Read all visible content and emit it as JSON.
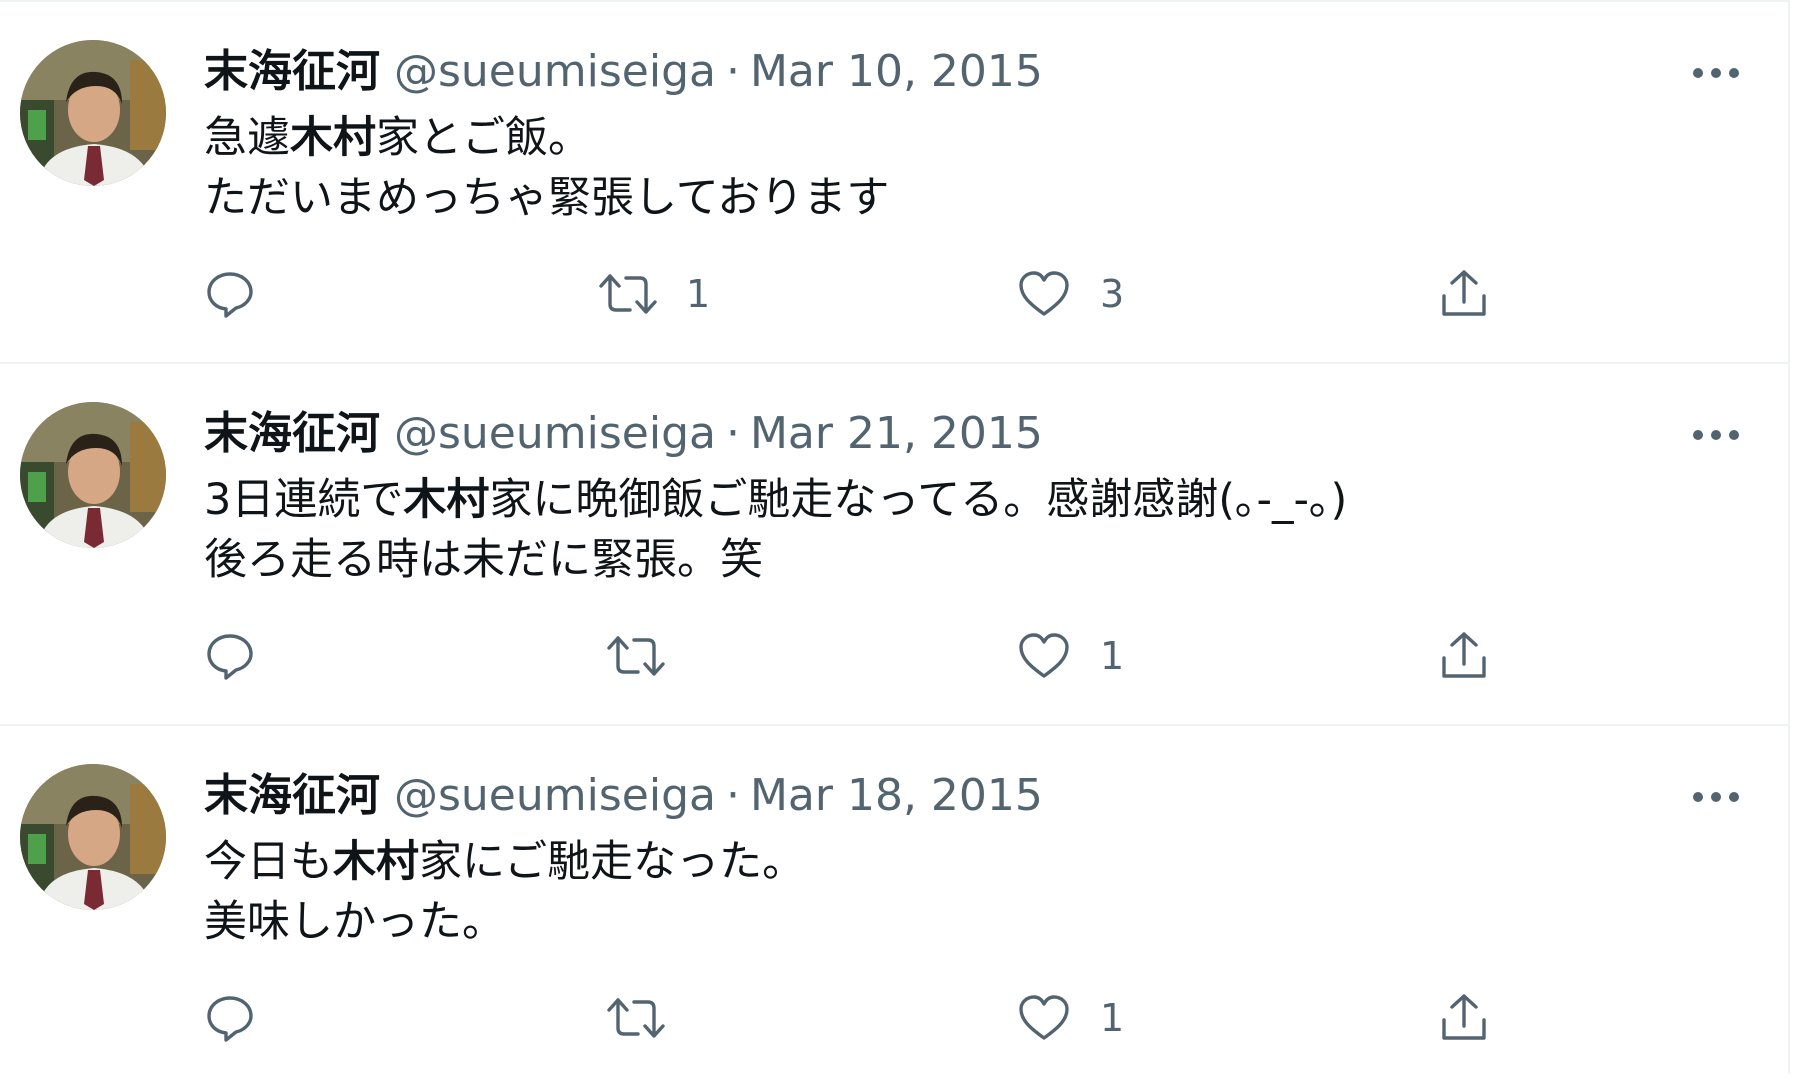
{
  "tweets": [
    {
      "author_name": "末海征河",
      "handle": "@sueumiseiga",
      "separator": "·",
      "date": "Mar 10, 2015",
      "lines": [
        {
          "pre": "急遽",
          "strong": "木村",
          "post": "家とご飯。"
        },
        {
          "pre": "ただいまめっちゃ緊張しております",
          "strong": "",
          "post": ""
        }
      ],
      "retweet_count": "1",
      "like_count": "3"
    },
    {
      "author_name": "末海征河",
      "handle": "@sueumiseiga",
      "separator": "·",
      "date": "Mar 21, 2015",
      "lines": [
        {
          "pre": "3日連続で",
          "strong": "木村",
          "post": "家に晩御飯ご馳走なってる。感謝感謝(｡-_-｡)"
        },
        {
          "pre": "後ろ走る時は未だに緊張。笑",
          "strong": "",
          "post": ""
        }
      ],
      "retweet_count": "",
      "like_count": "1"
    },
    {
      "author_name": "末海征河",
      "handle": "@sueumiseiga",
      "separator": "·",
      "date": "Mar 18, 2015",
      "lines": [
        {
          "pre": "今日も",
          "strong": "木村",
          "post": "家にご馳走なった。"
        },
        {
          "pre": "美味しかった。",
          "strong": "",
          "post": ""
        }
      ],
      "retweet_count": "",
      "like_count": "1"
    }
  ],
  "icons": {
    "reply": "reply-icon",
    "retweet": "retweet-icon",
    "like": "like-icon",
    "share": "share-icon",
    "more": "more-icon"
  },
  "colors": {
    "text": "#0f1419",
    "secondary": "#536471",
    "divider": "#eff3f4"
  }
}
